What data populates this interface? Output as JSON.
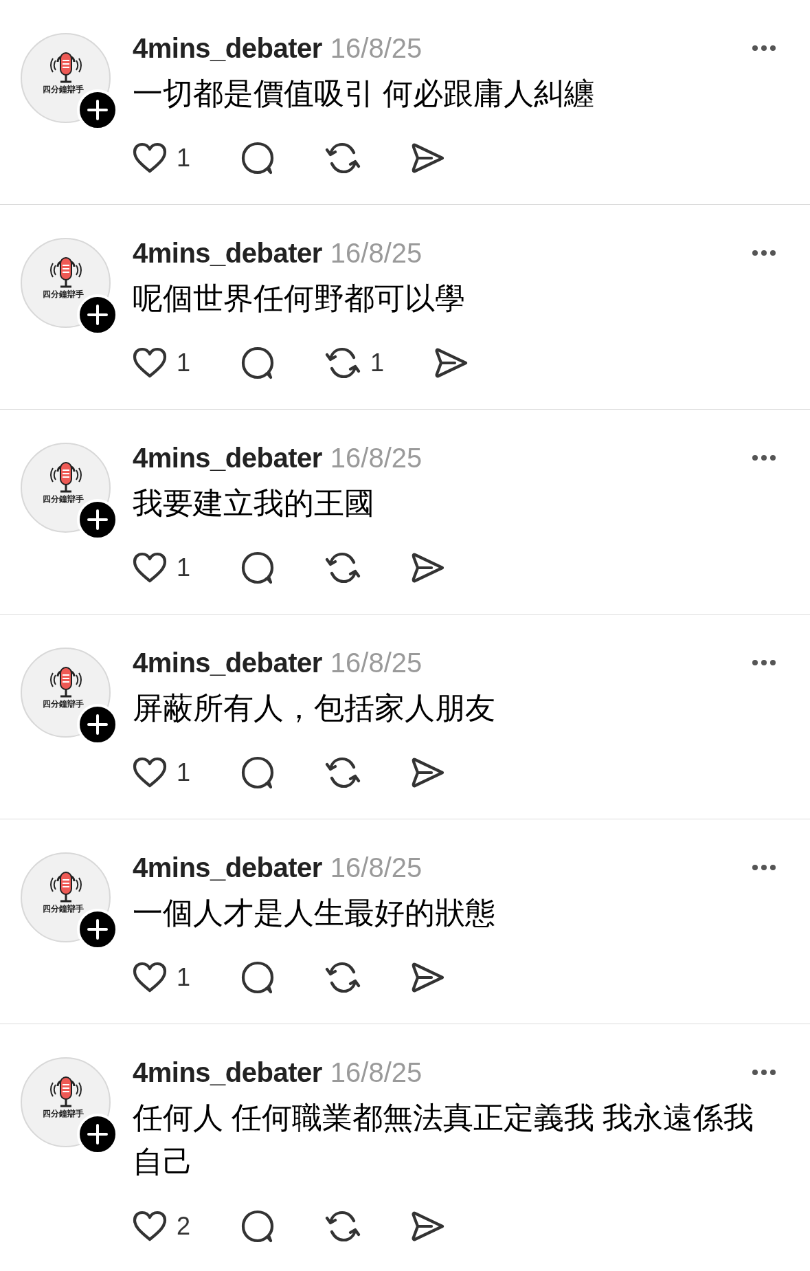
{
  "posts": [
    {
      "avatar_text": "四分鐘辯手",
      "username": "4mins_debater",
      "date": "16/8/25",
      "text": "一切都是價值吸引 何必跟庸人糾纏",
      "likes": "1"
    },
    {
      "avatar_text": "四分鐘辯手",
      "username": "4mins_debater",
      "date": "16/8/25",
      "text": "呢個世界任何野都可以學",
      "likes": "1",
      "reposts": "1"
    },
    {
      "avatar_text": "四分鐘辯手",
      "username": "4mins_debater",
      "date": "16/8/25",
      "text": "我要建立我的王國",
      "likes": "1"
    },
    {
      "avatar_text": "四分鐘辯手",
      "username": "4mins_debater",
      "date": "16/8/25",
      "text": "屏蔽所有人，包括家人朋友",
      "likes": "1"
    },
    {
      "avatar_text": "四分鐘辯手",
      "username": "4mins_debater",
      "date": "16/8/25",
      "text": "一個人才是人生最好的狀態",
      "likes": "1"
    },
    {
      "avatar_text": "四分鐘辯手",
      "username": "4mins_debater",
      "date": "16/8/25",
      "text": "任何人 任何職業都無法真正定義我 我永遠係我自己",
      "likes": "2"
    }
  ]
}
